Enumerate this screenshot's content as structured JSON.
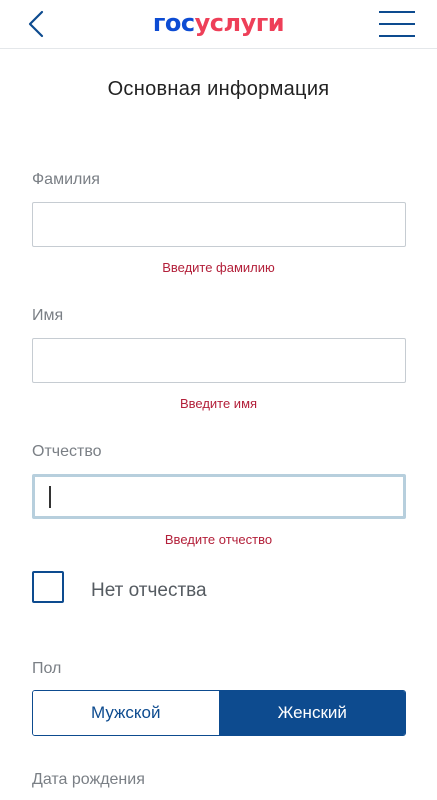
{
  "header": {
    "logo_part1": "гос",
    "logo_part2": "услуги",
    "back_icon": "chevron-left-icon",
    "menu_icon": "hamburger-menu-icon"
  },
  "page": {
    "title": "Основная информация"
  },
  "form": {
    "last_name": {
      "label": "Фамилия",
      "value": "",
      "error": "Введите фамилию"
    },
    "first_name": {
      "label": "Имя",
      "value": "",
      "error": "Введите имя"
    },
    "middle_name": {
      "label": "Отчество",
      "value": "",
      "error": "Введите отчество",
      "focused": true
    },
    "no_middle_name": {
      "label": "Нет отчества",
      "checked": false
    },
    "gender": {
      "label": "Пол",
      "options": [
        "Мужской",
        "Женский"
      ],
      "selected": "Женский"
    },
    "birth_date": {
      "label": "Дата рождения"
    }
  },
  "colors": {
    "brand_blue": "#0d4cd3",
    "brand_red": "#ee3f58",
    "accent": "#0d4b8f",
    "error": "#b3203a",
    "label": "#7a7f85"
  }
}
